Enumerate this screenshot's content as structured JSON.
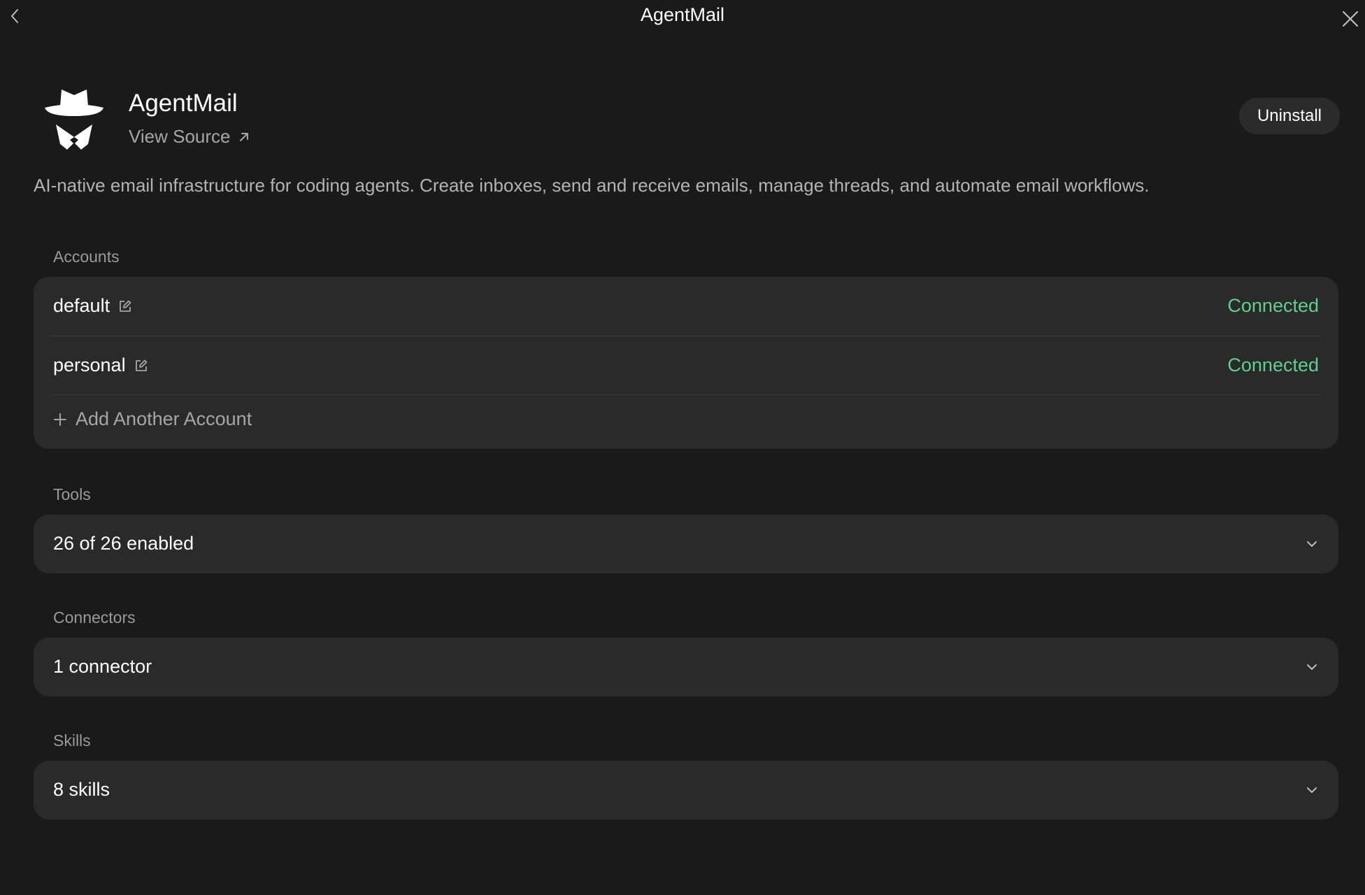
{
  "window": {
    "title": "AgentMail"
  },
  "app": {
    "name": "AgentMail",
    "view_source_label": "View Source",
    "uninstall_label": "Uninstall",
    "description": "AI-native email infrastructure for coding agents. Create inboxes, send and receive emails, manage threads, and automate email workflows.",
    "logo_icon": "spy-hat-icon"
  },
  "accounts": {
    "label": "Accounts",
    "items": [
      {
        "name": "default",
        "status": "Connected"
      },
      {
        "name": "personal",
        "status": "Connected"
      }
    ],
    "add_label": "Add Another Account"
  },
  "tools": {
    "label": "Tools",
    "summary": "26 of 26 enabled"
  },
  "connectors": {
    "label": "Connectors",
    "summary": "1 connector"
  },
  "skills": {
    "label": "Skills",
    "summary": "8 skills"
  },
  "colors": {
    "background": "#1a1a1a",
    "card": "#2a2a2a",
    "connected": "#5fcf8f",
    "muted_text": "#9a9a9a"
  }
}
